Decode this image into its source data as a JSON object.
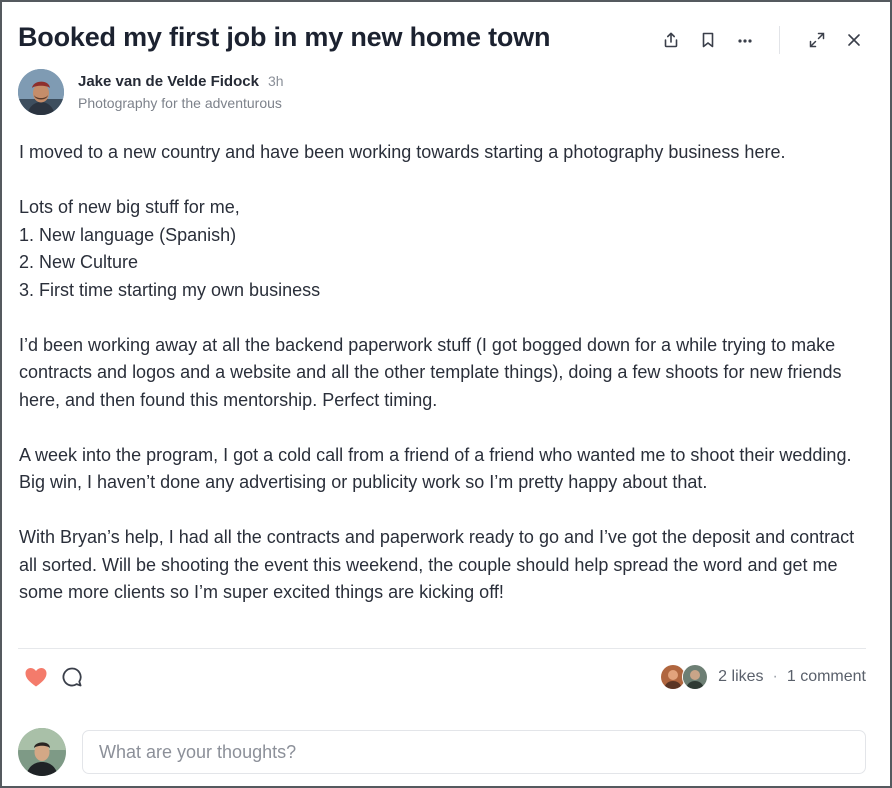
{
  "post": {
    "title": "Booked my first job in my new home town",
    "author": {
      "name": "Jake van de Velde Fidock",
      "time": "3h",
      "subtitle": "Photography for the adventurous"
    },
    "paragraphs": [
      "I moved to a new country and have been working towards starting a photography business here.",
      "Lots of new big stuff for me,\n1. New language (Spanish)\n2. New Culture\n3. First time starting my own business",
      "I’d been working away at all the backend paperwork stuff (I got bogged down for a while trying to make contracts and logos and a website and all the other template things), doing a few shoots for new friends here, and then found this mentorship. Perfect timing.",
      "A week into the program, I got a cold call from a friend of a friend who wanted me to shoot their wedding. Big win, I haven’t done any advertising or publicity work so I’m pretty happy about that.",
      "With Bryan’s help, I had all the contracts and paperwork ready to go and I’ve got the deposit and contract all sorted. Will be shooting the event this weekend, the couple should help spread the word and get me some more clients so I’m super excited things are kicking off!"
    ]
  },
  "toolbar": {
    "icons": [
      "share-icon",
      "bookmark-icon",
      "more-icon",
      "expand-icon",
      "close-icon"
    ]
  },
  "reactions": {
    "likes": "2 likes",
    "separator": "·",
    "comments": "1 comment",
    "liked": true,
    "heart_color": "#f47b6b"
  },
  "comment_box": {
    "placeholder": "What are your thoughts?"
  }
}
